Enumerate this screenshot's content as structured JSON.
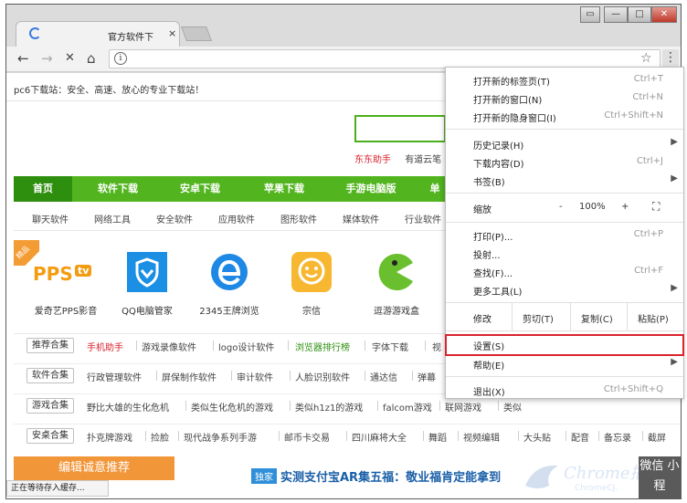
{
  "browser": {
    "tab_title": "官方软件下",
    "tab_close": "×",
    "window_controls": [
      "▭",
      "—",
      "□",
      "✕"
    ],
    "nav": {
      "back": "←",
      "forward": "→",
      "stop": "✕",
      "home": "⌂",
      "info": "i",
      "star": "☆",
      "menu": "⋮"
    }
  },
  "page": {
    "slogan": "pc6下载站：安全、高速、放心的专业下载站！",
    "hotwords": [
      "东东助手",
      "有道云笔"
    ],
    "main_nav": [
      "首页",
      "软件下载",
      "安卓下载",
      "苹果下载",
      "手游电脑版",
      "单"
    ],
    "sub_nav": [
      "聊天软件",
      "网络工具",
      "安全软件",
      "应用软件",
      "图形软件",
      "媒体软件",
      "行业软件"
    ],
    "badge": "精品",
    "apps": [
      {
        "name": "爱奇艺PPS影音",
        "icon": "pps-logo-icon"
      },
      {
        "name": "QQ电脑管家",
        "icon": "qq-shield-icon"
      },
      {
        "name": "2345王牌浏览",
        "icon": "browser-e-icon"
      },
      {
        "name": "宗信",
        "icon": "smile-face-icon"
      },
      {
        "name": "逗游游戏盒",
        "icon": "pacman-icon"
      }
    ],
    "pps_text": "PPS",
    "pps_tv": "tv",
    "tag_rows": [
      {
        "label": "推荐合集",
        "items": [
          "手机助手",
          "游戏录像软件",
          "logo设计软件",
          "浏览器排行榜",
          "字体下载",
          "视"
        ]
      },
      {
        "label": "软件合集",
        "items": [
          "行政管理软件",
          "屏保制作软件",
          "审计软件",
          "人脸识别软件",
          "通达信",
          "弹幕"
        ]
      },
      {
        "label": "游戏合集",
        "items": [
          "野比大雄的生化危机",
          "类似生化危机的游戏",
          "类似h1z1的游戏",
          "falcom游戏",
          "联网游戏",
          "类似"
        ]
      },
      {
        "label": "安桌合集",
        "items": [
          "扑克牌游戏",
          "捡脸",
          "现代战争系列手游",
          "邮币卡交易",
          "四川麻将大全",
          "舞蹈",
          "视频编辑",
          "大头贴",
          "配音",
          "备忘录",
          "截屏"
        ]
      }
    ],
    "bottom_banner": "编辑诚意推荐",
    "news_tag": "独家",
    "news_text": "实测支付宝AR集五福：敬业福肯定能拿到",
    "watermark_main": "Chrome插",
    "watermark_sub": "ChromeCJ.",
    "watermark_cube": "微信 小程",
    "status_text": "正在等待存入缓存..."
  },
  "menu": {
    "group1": [
      {
        "label": "打开新的标签页(T)",
        "shortcut": "Ctrl+T"
      },
      {
        "label": "打开新的窗口(N)",
        "shortcut": "Ctrl+N"
      },
      {
        "label": "打开新的隐身窗口(I)",
        "shortcut": "Ctrl+Shift+N"
      }
    ],
    "group2": [
      {
        "label": "历史记录(H)",
        "shortcut": ""
      },
      {
        "label": "下载内容(D)",
        "shortcut": "Ctrl+J"
      },
      {
        "label": "书签(B)",
        "shortcut": ""
      }
    ],
    "zoom": {
      "label": "缩放",
      "minus": "-",
      "value": "100%",
      "plus": "+",
      "fullscreen": "⛶"
    },
    "group3": [
      {
        "label": "打印(P)...",
        "shortcut": "Ctrl+P"
      },
      {
        "label": "投射...",
        "shortcut": ""
      },
      {
        "label": "查找(F)...",
        "shortcut": "Ctrl+F"
      },
      {
        "label": "更多工具(L)",
        "shortcut": ""
      }
    ],
    "edit": {
      "label": "修改",
      "cut": "剪切(T)",
      "copy": "复制(C)",
      "paste": "粘贴(P)"
    },
    "settings": "设置(S)",
    "help": "帮助(E)",
    "exit": {
      "label": "退出(X)",
      "shortcut": "Ctrl+Shift+Q"
    },
    "arrow": "▶"
  },
  "colors": {
    "green": "#52b51f",
    "highlight": "#d9232d",
    "orange": "#f2963a",
    "blue": "#2f8fd8"
  }
}
